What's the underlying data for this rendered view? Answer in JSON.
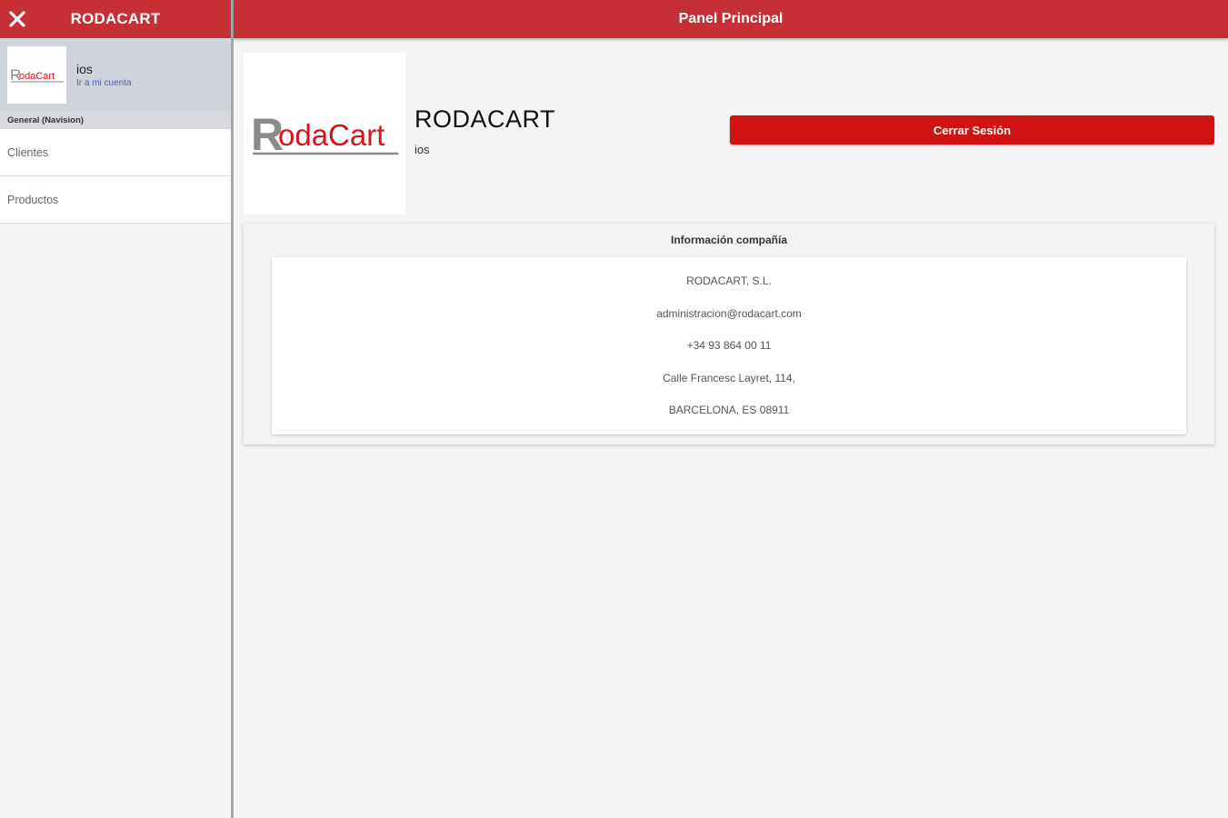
{
  "sidebar": {
    "title": "RODACART",
    "account": {
      "name": "ios",
      "link_text": "Ir a mi cuenta",
      "logo_text_r": "R",
      "logo_text_rest": "odaCart"
    },
    "section_header": "General (Navision)",
    "items": [
      {
        "label": "Clientes"
      },
      {
        "label": "Productos"
      }
    ]
  },
  "topbar": {
    "title": "Panel Principal"
  },
  "profile": {
    "name": "RODACART",
    "user": "ios",
    "logo_text_r": "R",
    "logo_text_rest": "odaCart",
    "logout_label": "Cerrar Sesión"
  },
  "company_info": {
    "title": "Información compañía",
    "lines": [
      "RODACART, S.L.",
      "administracion@rodacart.com",
      "+34 93 864 00 11",
      "Calle Francesc Layret, 114,",
      "BARCELONA, ES 08911"
    ]
  },
  "colors": {
    "header_red": "#c62f33",
    "button_red": "#d01212",
    "logo_gray": "#8a8a8a",
    "logo_red": "#d8141a",
    "link_blue": "#4a63b4"
  }
}
